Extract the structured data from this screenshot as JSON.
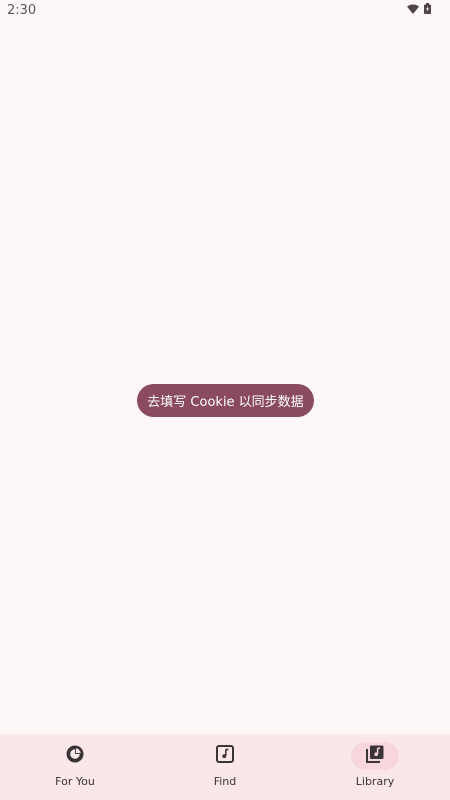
{
  "status_bar": {
    "time": "2:30",
    "icons": [
      "wifi-icon",
      "battery-icon"
    ]
  },
  "toast": {
    "message": "去填写 Cookie 以同步数据"
  },
  "bottom_nav": {
    "items": [
      {
        "label": "For You",
        "icon": "for-you-icon",
        "active": false
      },
      {
        "label": "Find",
        "icon": "music-note-icon",
        "active": false
      },
      {
        "label": "Library",
        "icon": "library-music-icon",
        "active": true
      }
    ]
  },
  "colors": {
    "background": "#FDF7F7",
    "nav_background": "#F9E7EA",
    "nav_active_indicator": "#F8D6DD",
    "toast_background": "#8A4B62",
    "icon": "#3b3335"
  }
}
